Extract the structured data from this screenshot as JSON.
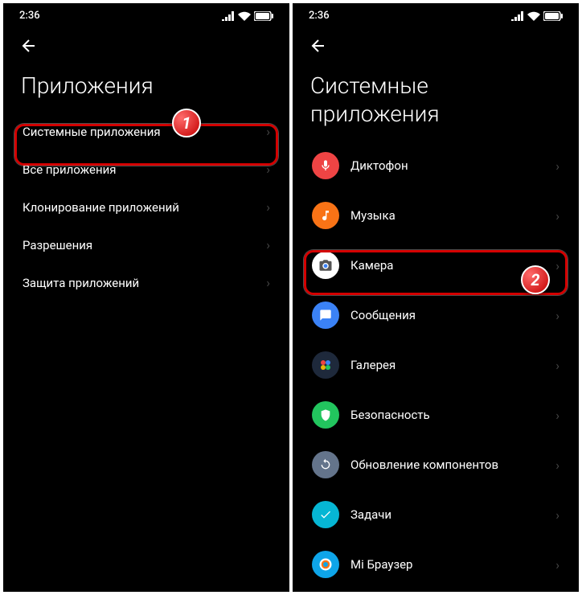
{
  "statusBar": {
    "time": "2:36"
  },
  "left": {
    "title": "Приложения",
    "items": [
      "Системные приложения",
      "Все приложения",
      "Клонирование приложений",
      "Разрешения",
      "Защита приложений"
    ]
  },
  "right": {
    "title": "Системные приложения",
    "items": [
      {
        "label": "Диктофон",
        "icon": "mic",
        "bg": "#ef4444"
      },
      {
        "label": "Музыка",
        "icon": "music",
        "bg": "#f97316"
      },
      {
        "label": "Камера",
        "icon": "camera",
        "bg": "#ffffff"
      },
      {
        "label": "Сообщения",
        "icon": "message",
        "bg": "#3b82f6"
      },
      {
        "label": "Галерея",
        "icon": "gallery",
        "bg": "#1e293b"
      },
      {
        "label": "Безопасность",
        "icon": "shield",
        "bg": "#22c55e"
      },
      {
        "label": "Обновление компонентов",
        "icon": "update",
        "bg": "#64748b"
      },
      {
        "label": "Задачи",
        "icon": "tasks",
        "bg": "#06b6d4"
      },
      {
        "label": "Mi Браузер",
        "icon": "browser",
        "bg": "#0ea5e9"
      }
    ]
  },
  "steps": {
    "1": "1",
    "2": "2"
  }
}
